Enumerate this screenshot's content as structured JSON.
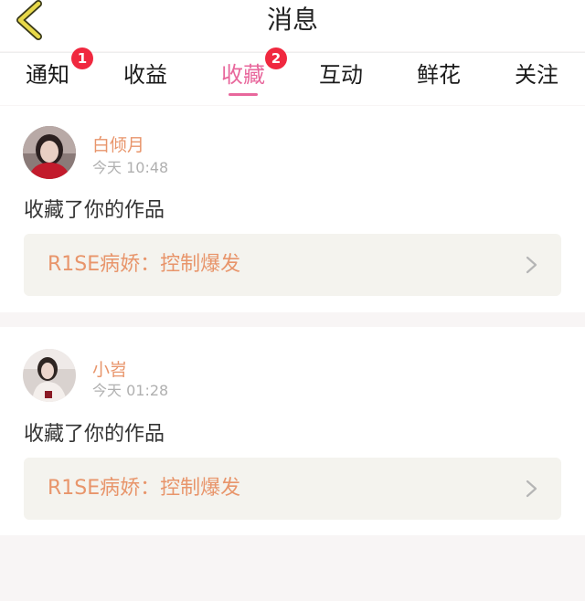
{
  "header": {
    "title": "消息",
    "back_icon": "chevron-left-icon",
    "back_icon_color": "#e8d94a"
  },
  "tabs": [
    {
      "label": "通知",
      "badge": "1",
      "active": false
    },
    {
      "label": "收益",
      "badge": "",
      "active": false
    },
    {
      "label": "收藏",
      "badge": "2",
      "active": true
    },
    {
      "label": "互动",
      "badge": "",
      "active": false
    },
    {
      "label": "鲜花",
      "badge": "",
      "active": false
    },
    {
      "label": "关注",
      "badge": "",
      "active": false
    }
  ],
  "colors": {
    "accent": "#e8679c",
    "badge": "#f0283f",
    "username": "#e8956b",
    "work_box_bg": "#f4f3ee"
  },
  "notifications": [
    {
      "username": "白倾月",
      "time": "今天 10:48",
      "action": "收藏了你的作品",
      "work_title": "R1SE病娇：控制爆发"
    },
    {
      "username": "小岧",
      "time": "今天 01:28",
      "action": "收藏了你的作品",
      "work_title": "R1SE病娇：控制爆发"
    }
  ]
}
